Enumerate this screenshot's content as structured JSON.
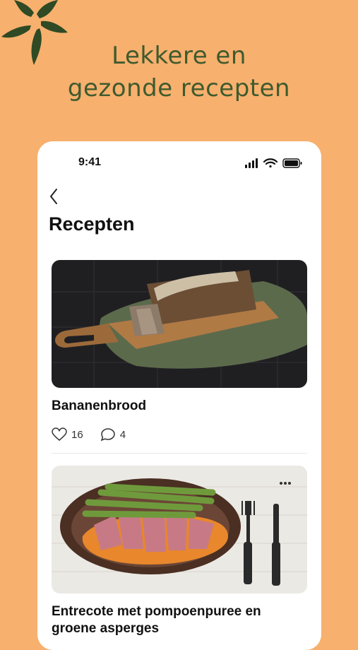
{
  "headline": {
    "line1": "Lekkere en",
    "line2": "gezonde recepten"
  },
  "status": {
    "time": "9:41"
  },
  "page": {
    "title": "Recepten"
  },
  "recipes": [
    {
      "title": "Bananenbrood",
      "likes": "16",
      "comments": "4"
    },
    {
      "title": "Entrecote met pompoenpuree en groene asperges"
    }
  ],
  "colors": {
    "background": "#f7b06e",
    "headline": "#3f5a2e",
    "card_bg": "#ffffff"
  },
  "icons": [
    "leaf-logo-icon",
    "signal-icon",
    "wifi-icon",
    "battery-icon",
    "back-chevron-icon",
    "heart-icon",
    "comment-icon",
    "more-icon"
  ]
}
